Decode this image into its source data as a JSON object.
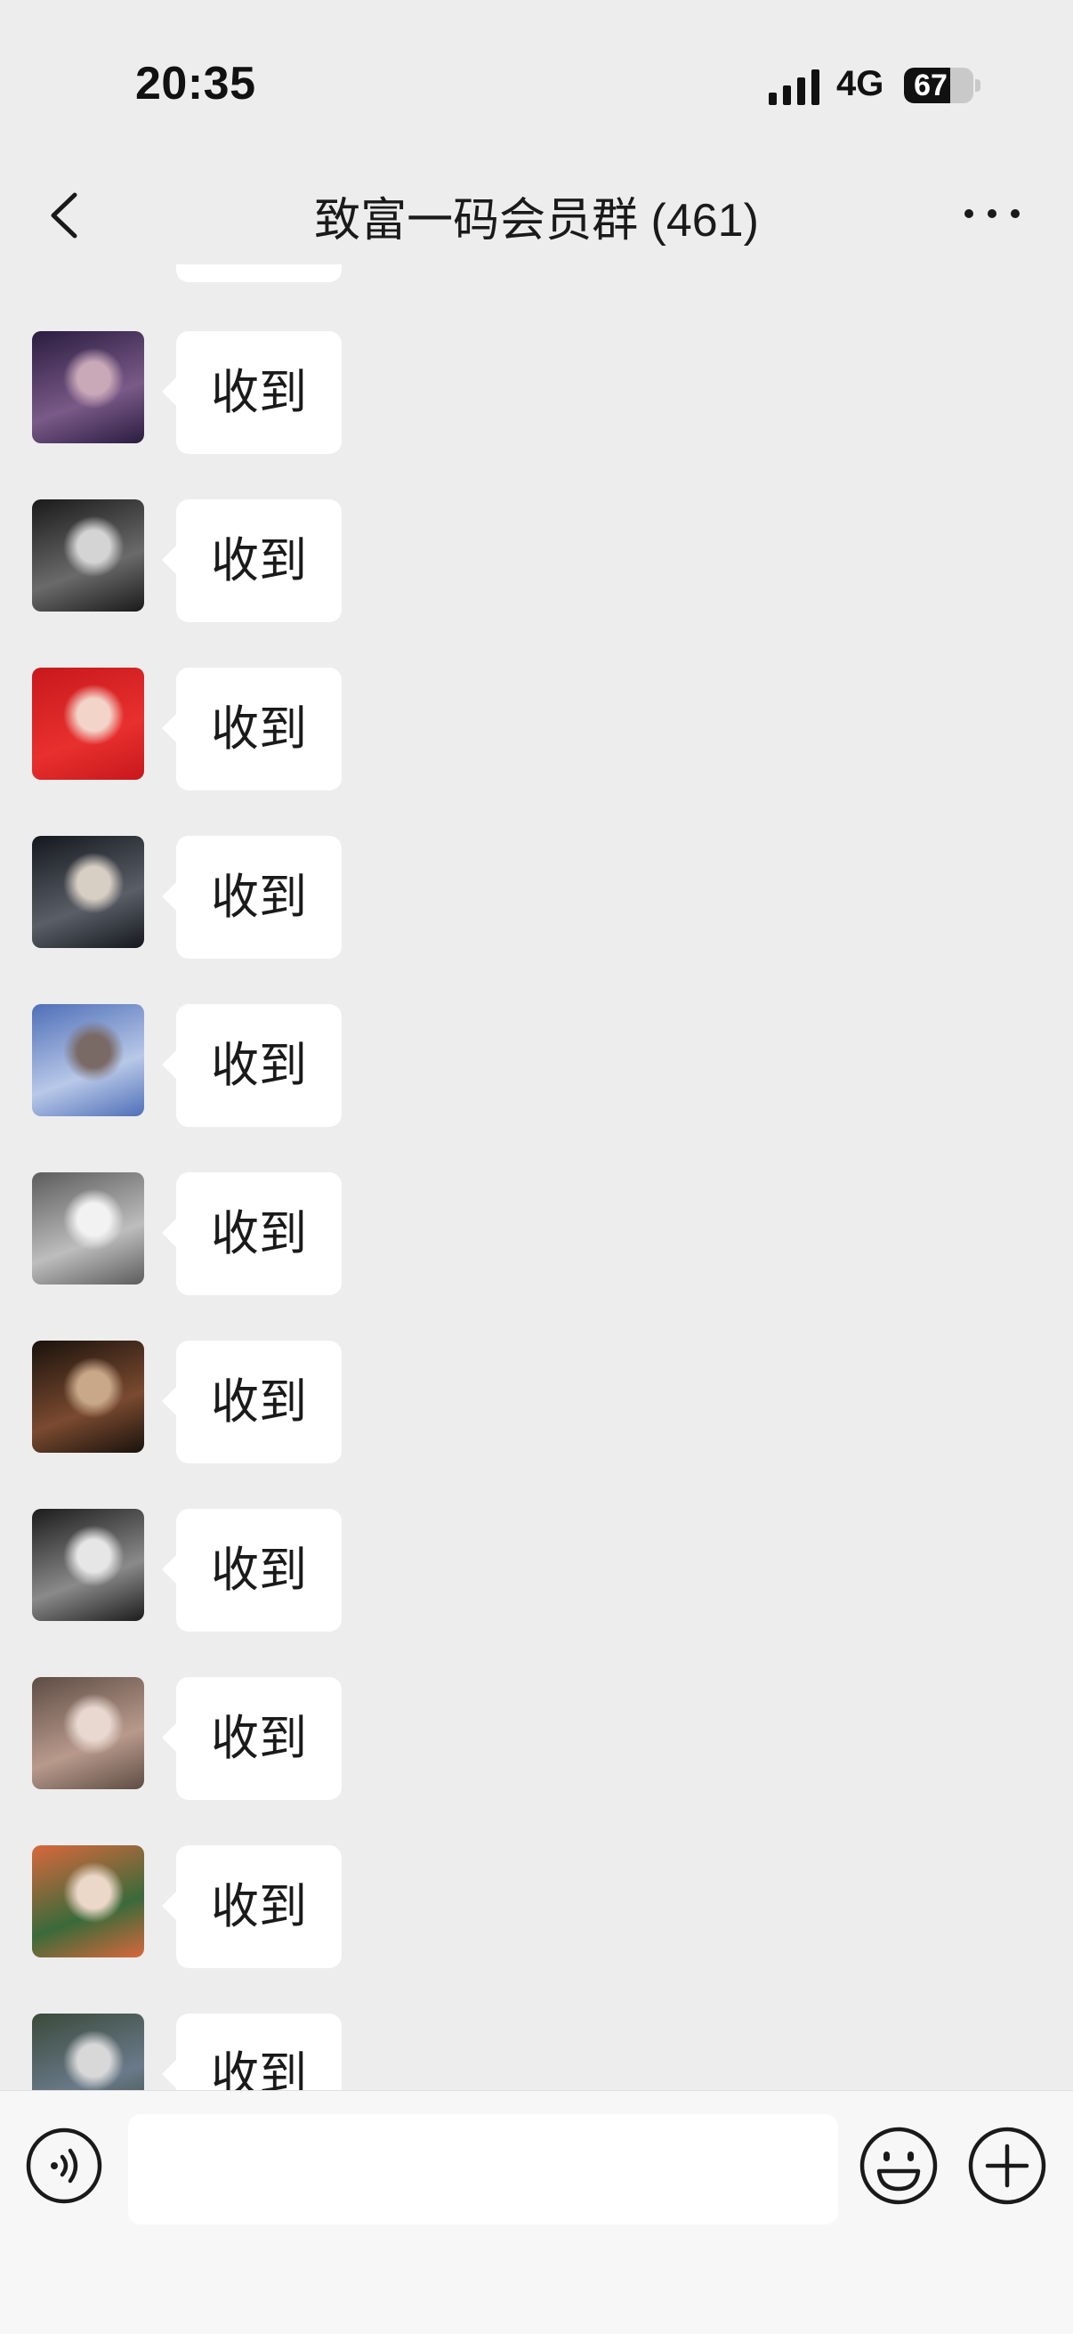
{
  "status_bar": {
    "time": "20:35",
    "network": "4G",
    "battery": "67",
    "battery_level": 0.67
  },
  "nav": {
    "title": "致富一码会员群 (461)"
  },
  "icons": {
    "back": "chevron-left-icon",
    "more": "more-dots-icon",
    "voice": "voice-icon",
    "emoji": "emoji-icon",
    "plus": "plus-icon"
  },
  "messages": [
    {
      "text": "收到",
      "avatar_colors": [
        "#2a1c3f",
        "#7a5a88",
        "#c9a8b8"
      ]
    },
    {
      "text": "收到",
      "avatar_colors": [
        "#1a1a1a",
        "#6a6a6a",
        "#d4d4d4"
      ]
    },
    {
      "text": "收到",
      "avatar_colors": [
        "#c8181c",
        "#e8302e",
        "#f3d4c8"
      ]
    },
    {
      "text": "收到",
      "avatar_colors": [
        "#14181e",
        "#5a5e66",
        "#d8cfc4"
      ]
    },
    {
      "text": "收到",
      "avatar_colors": [
        "#4f6fb8",
        "#b8c8e8",
        "#7a6a66"
      ]
    },
    {
      "text": "收到",
      "avatar_colors": [
        "#5c5c5c",
        "#bdbdbd",
        "#f2f2f2"
      ]
    },
    {
      "text": "收到",
      "avatar_colors": [
        "#1a120c",
        "#7a4a30",
        "#c8a888"
      ]
    },
    {
      "text": "收到",
      "avatar_colors": [
        "#1c1c1c",
        "#8a8a8a",
        "#e6e6e6"
      ]
    },
    {
      "text": "收到",
      "avatar_colors": [
        "#5e4c44",
        "#b89a8c",
        "#e8d8d0"
      ]
    },
    {
      "text": "收到",
      "avatar_colors": [
        "#d8683c",
        "#3a6a3a",
        "#ecd8c8"
      ]
    },
    {
      "text": "收到",
      "avatar_colors": [
        "#3a4a3a",
        "#6a7a8a",
        "#d8d8d8"
      ]
    }
  ],
  "input": {
    "value": "",
    "placeholder": ""
  },
  "colors": {
    "background": "#ededed",
    "bubble": "#ffffff",
    "input_bar": "#f7f7f7"
  }
}
